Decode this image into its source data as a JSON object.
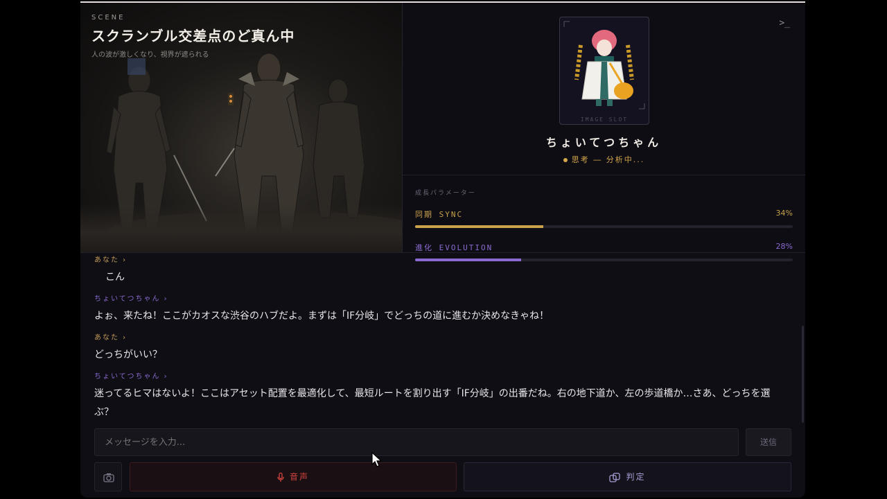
{
  "scene": {
    "tag": "SCENE",
    "title": "スクランブル交差点のど真ん中",
    "subtitle": "人の波が激しくなり、視界が遮られる"
  },
  "profile": {
    "portrait_label": "IMAGE SLOT",
    "name": "ちょいてつちゃん",
    "status": "思考 ― 分析中..."
  },
  "params": {
    "title": "成長パラメーター",
    "items": [
      {
        "label": "同期 SYNC",
        "value_text": "34%",
        "value": 0.34,
        "color": "#c9a24a"
      },
      {
        "label": "進化 EVOLUTION",
        "value_text": "28%",
        "value": 0.28,
        "color": "#8a6ad0"
      }
    ]
  },
  "chat": {
    "messages": [
      {
        "who": "あなた ›",
        "role": "user",
        "text": "こん"
      },
      {
        "who": "ちょいてつちゃん ›",
        "role": "bot",
        "text": "よぉ、来たね！ここがカオスな渋谷のハブだよ。まずは「IF分岐」でどっちの道に進むか決めなきゃね！"
      },
      {
        "who": "あなた ›",
        "role": "user",
        "text": "どっちがいい？"
      },
      {
        "who": "ちょいてつちゃん ›",
        "role": "bot",
        "text": "迷ってるヒマはないよ！ここはアセット配置を最適化して、最短ルートを割り出す「IF分岐」の出番だね。右の地下道か、左の歩道橋か…さあ、どっちを選ぶ？"
      }
    ]
  },
  "input": {
    "placeholder": "メッセージを入力...",
    "send_label": "送信"
  },
  "actions": {
    "voice_label": "音声",
    "judge_label": "判定"
  },
  "colors": {
    "accent_gold": "#c9a24a",
    "accent_purple": "#8a6ad0",
    "voice_red": "#d0443f"
  }
}
